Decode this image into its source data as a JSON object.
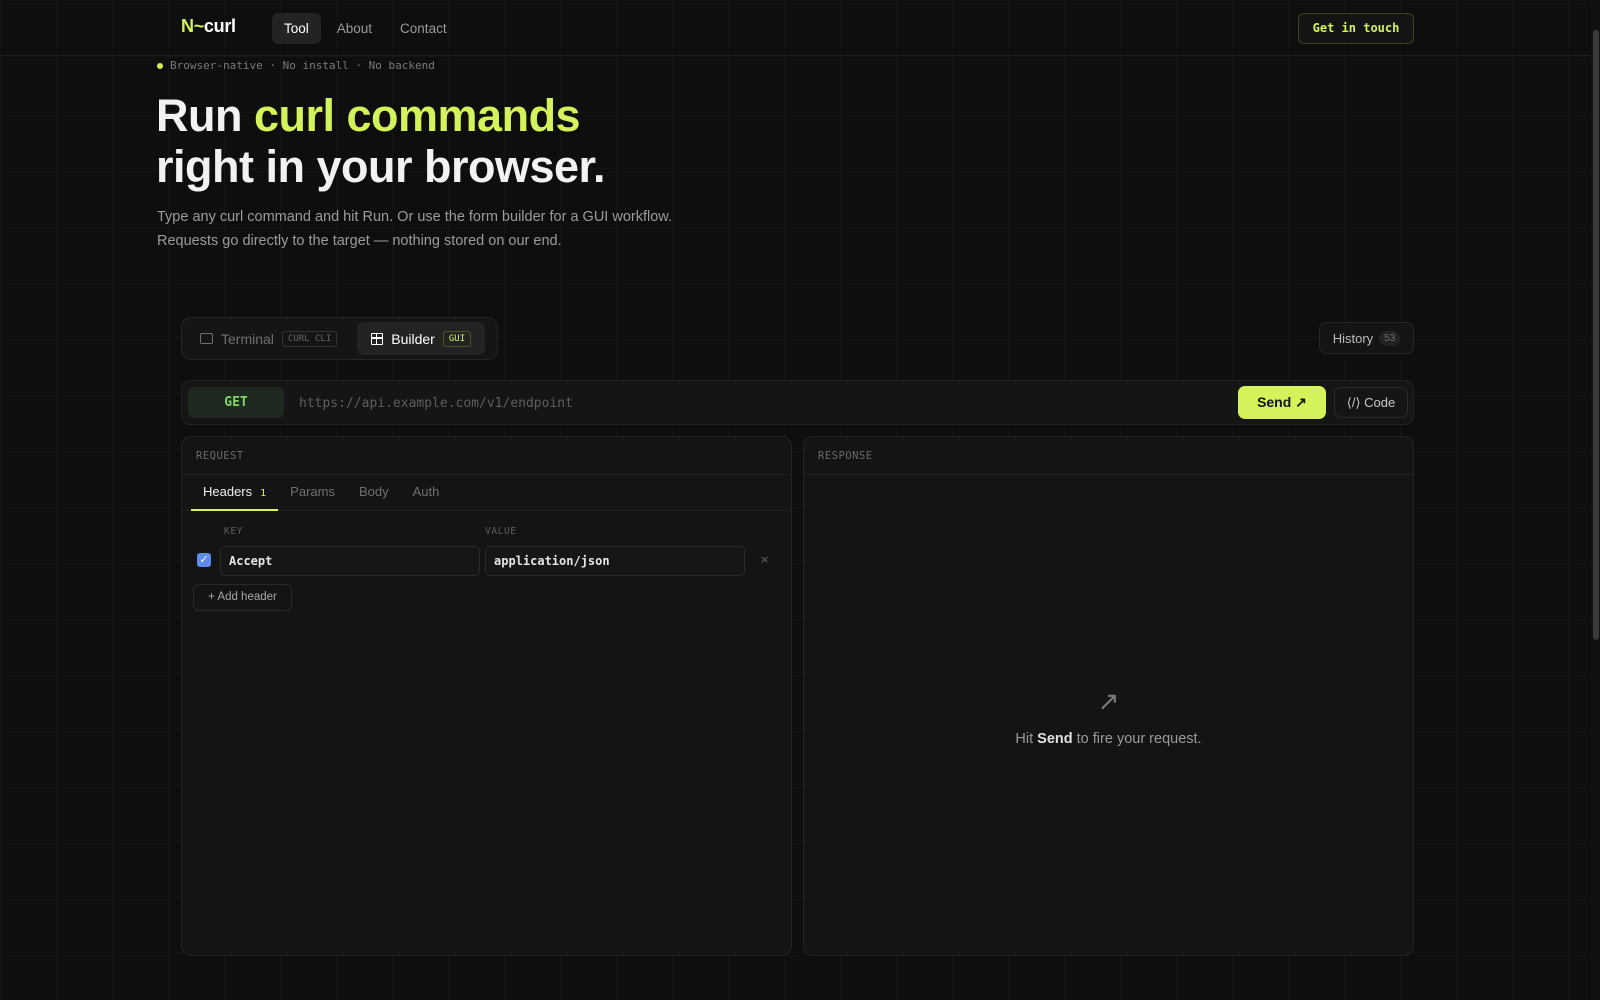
{
  "nav": {
    "logo_mark": "N~",
    "logo_word": "curl",
    "links": [
      "Tool",
      "About",
      "Contact"
    ],
    "cta": "Get in touch"
  },
  "hero": {
    "eyebrow": "Browser-native · No install · No backend",
    "title_part1": "Run ",
    "title_accent": "curl commands",
    "title_line2": "right in your browser.",
    "desc_line1": "Type any curl command and hit Run. Or use the form builder for a GUI workflow.",
    "desc_line2": "Requests go directly to the target — nothing stored on our end."
  },
  "modes": {
    "terminal": {
      "label": "Terminal",
      "badge": "CURL CLI"
    },
    "builder": {
      "label": "Builder",
      "badge": "GUI"
    },
    "active": "builder"
  },
  "history": {
    "label": "History",
    "count": "53"
  },
  "request_bar": {
    "method": "GET",
    "url_placeholder": "https://api.example.com/v1/endpoint",
    "send_label": "Send ↗",
    "code_label": "⟨/⟩ Code"
  },
  "request_panel": {
    "title": "REQUEST",
    "tabs": [
      {
        "label": "Headers",
        "count": "1"
      },
      {
        "label": "Params"
      },
      {
        "label": "Body"
      },
      {
        "label": "Auth"
      }
    ],
    "active_tab": "Headers",
    "col_key": "KEY",
    "col_value": "VALUE",
    "headers": [
      {
        "enabled": true,
        "key": "Accept",
        "value": "application/json"
      }
    ],
    "add_header_label": "+ Add header",
    "remove_glyph": "×"
  },
  "response_panel": {
    "title": "RESPONSE",
    "empty_pre": "Hit ",
    "empty_strong": "Send",
    "empty_post": " to fire your request.",
    "empty_icon": "↗"
  },
  "colors": {
    "accent": "#d4f35a",
    "method_get": "#7fd66a",
    "background": "#0e0e0e"
  }
}
